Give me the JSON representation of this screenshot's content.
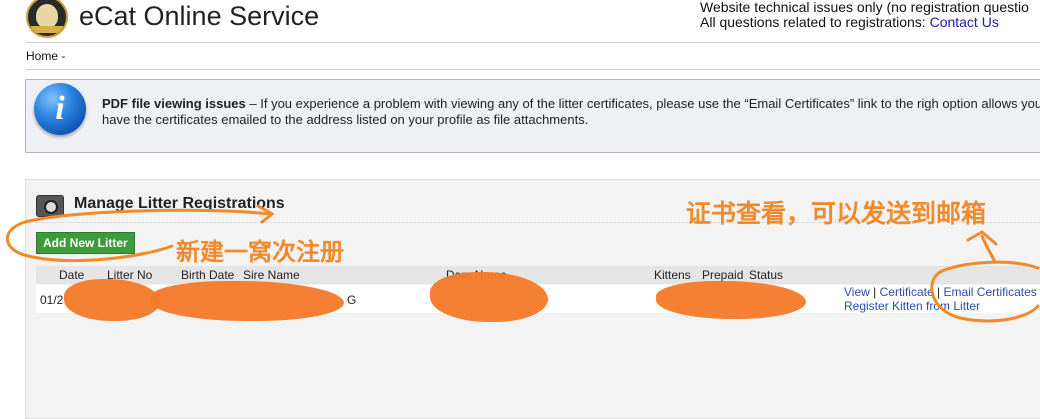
{
  "header": {
    "app_title": "eCat Online Service",
    "notice_line1": "Website technical issues only (no registration questio",
    "notice_line2_prefix": "All questions related to registrations: ",
    "contact_link": "Contact Us"
  },
  "breadcrumb": {
    "home": "Home -"
  },
  "info_box": {
    "bold_title": "PDF file viewing issues",
    "message": " – If you experience a problem with viewing any of the litter certificates, please use the “Email Certificates” link to the righ option allows you to have the certificates emailed to the address listed on your profile as file attachments."
  },
  "panel": {
    "title": "Manage Litter Registrations",
    "add_button": "Add New Litter",
    "columns": {
      "date": "Date",
      "litter_no": "Litter No",
      "birth_date": "Birth Date",
      "sire_name": "Sire Name",
      "dam_name": "Dam Name",
      "kittens": "Kittens",
      "prepaid": "Prepaid",
      "status": "Status"
    },
    "row": {
      "date_partial": "01/2",
      "sire_tail": "G",
      "actions": {
        "view": "View",
        "certificate": "Certificate",
        "email_certificates": "Email Certificates",
        "register_kitten": "Register Kitten from Litter",
        "separator": "|"
      }
    }
  },
  "annotations": {
    "new_litter_note": "新建一窝次注册",
    "certificate_note": "证书查看，可以发送到邮箱",
    "color": "#f08a2a"
  }
}
